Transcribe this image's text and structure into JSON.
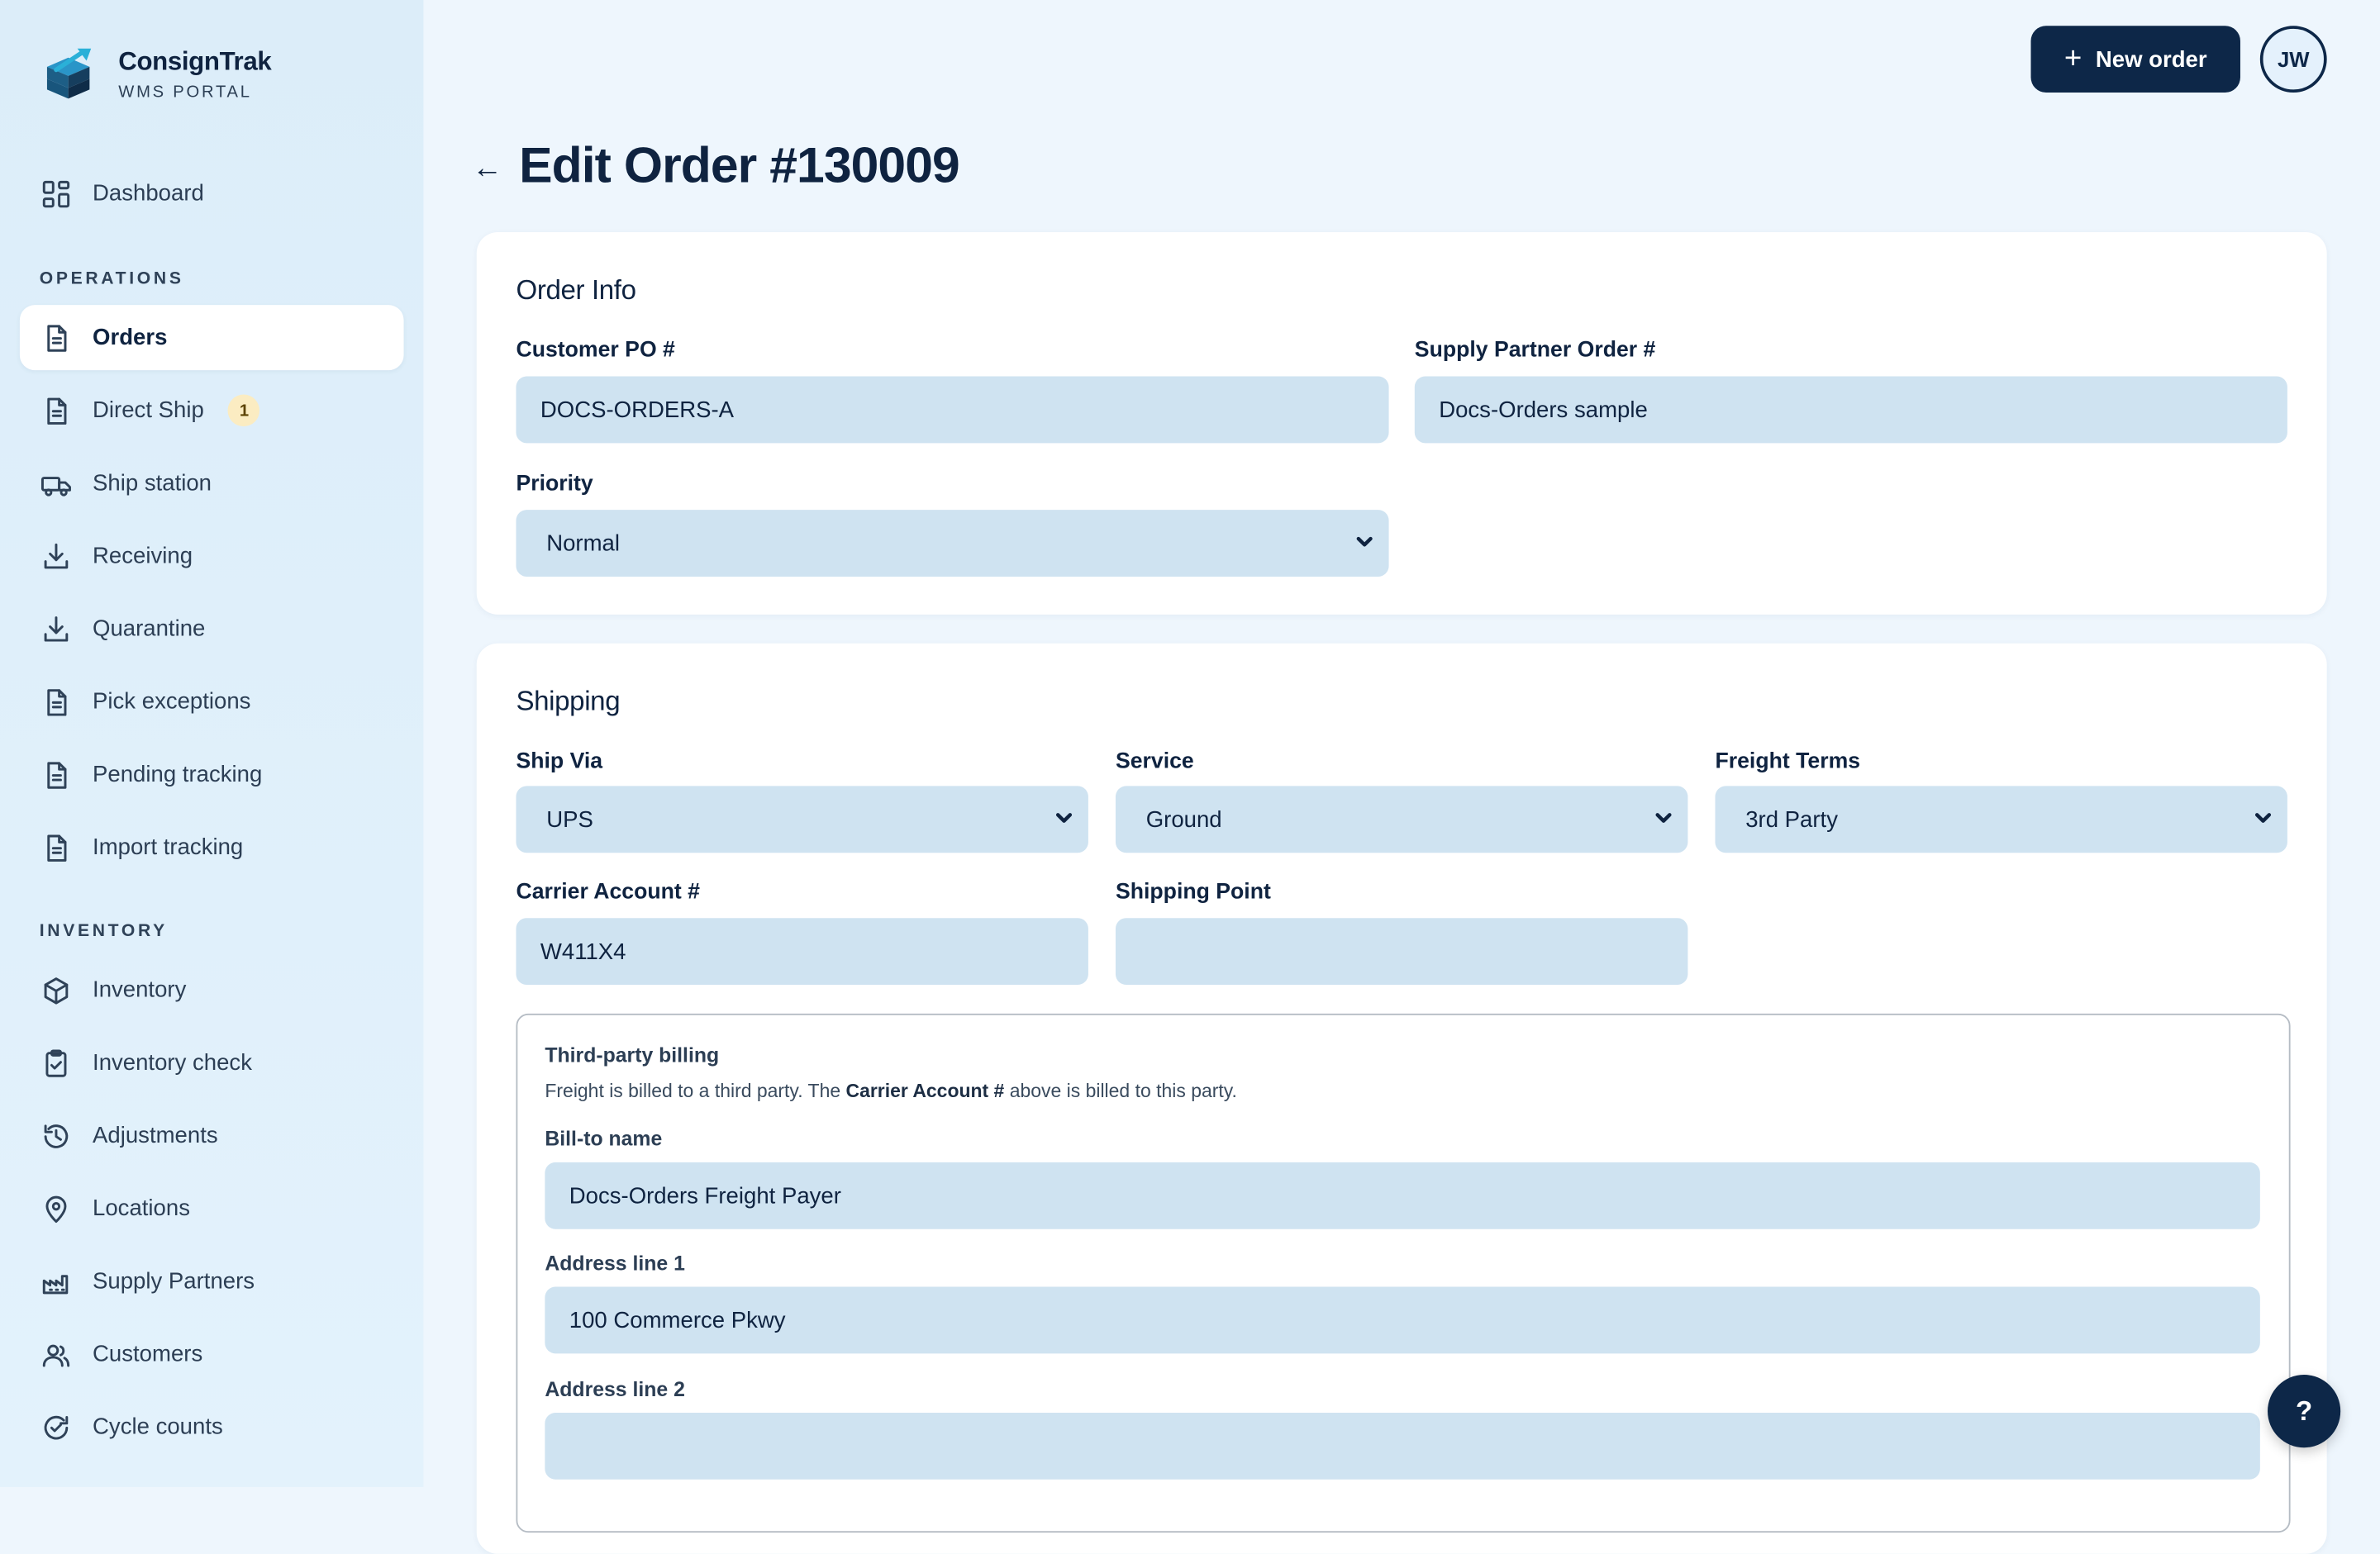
{
  "app": {
    "name": "ConsignTrak",
    "subtitle": "WMS PORTAL"
  },
  "sidebar": {
    "dashboard": {
      "label": "Dashboard",
      "icon": "grid-icon"
    },
    "sections": [
      {
        "title": "OPERATIONS"
      },
      {
        "title": "INVENTORY"
      }
    ],
    "operations": [
      {
        "label": "Orders",
        "icon": "document-icon",
        "active": true
      },
      {
        "label": "Direct Ship",
        "icon": "document-icon",
        "badge": "1"
      },
      {
        "label": "Ship station",
        "icon": "truck-icon"
      },
      {
        "label": "Receiving",
        "icon": "download-icon"
      },
      {
        "label": "Quarantine",
        "icon": "download-icon"
      },
      {
        "label": "Pick exceptions",
        "icon": "document-icon"
      },
      {
        "label": "Pending tracking",
        "icon": "document-icon"
      },
      {
        "label": "Import tracking",
        "icon": "document-icon"
      }
    ],
    "inventory": [
      {
        "label": "Inventory",
        "icon": "box-icon"
      },
      {
        "label": "Inventory check",
        "icon": "clipboard-check-icon"
      },
      {
        "label": "Adjustments",
        "icon": "history-icon"
      },
      {
        "label": "Locations",
        "icon": "map-pin-icon"
      },
      {
        "label": "Supply Partners",
        "icon": "factory-icon"
      },
      {
        "label": "Customers",
        "icon": "users-icon"
      },
      {
        "label": "Cycle counts",
        "icon": "refresh-check-icon"
      }
    ]
  },
  "header": {
    "new_order_label": "New order",
    "avatar_initials": "JW",
    "back_arrow": "←",
    "title": "Edit Order #130009"
  },
  "order_info": {
    "title": "Order Info",
    "customer_po_label": "Customer PO #",
    "customer_po_value": "DOCS-ORDERS-A",
    "supply_partner_label": "Supply Partner Order #",
    "supply_partner_value": "Docs-Orders sample",
    "priority_label": "Priority",
    "priority_value": "Normal"
  },
  "shipping": {
    "title": "Shipping",
    "ship_via_label": "Ship Via",
    "ship_via_value": "UPS",
    "service_label": "Service",
    "service_value": "Ground",
    "freight_terms_label": "Freight Terms",
    "freight_terms_value": "3rd Party",
    "carrier_account_label": "Carrier Account #",
    "carrier_account_value": "W411X4",
    "shipping_point_label": "Shipping Point",
    "shipping_point_value": ""
  },
  "billing": {
    "title": "Third-party billing",
    "desc_before": "Freight is billed to a third party. The ",
    "desc_bold": "Carrier Account #",
    "desc_after": " above is billed to this party.",
    "bill_to_label": "Bill-to name",
    "bill_to_value": "Docs-Orders Freight Payer",
    "address1_label": "Address line 1",
    "address1_value": "100 Commerce Pkwy",
    "address2_label": "Address line 2",
    "address2_value": ""
  },
  "help_label": "?",
  "colors": {
    "primary": "#0d2748",
    "input_bg": "#cfe3f1",
    "sidebar_bg": "#dcedf9",
    "page_bg": "#eef6fd",
    "badge_bg": "#fbecc2"
  }
}
